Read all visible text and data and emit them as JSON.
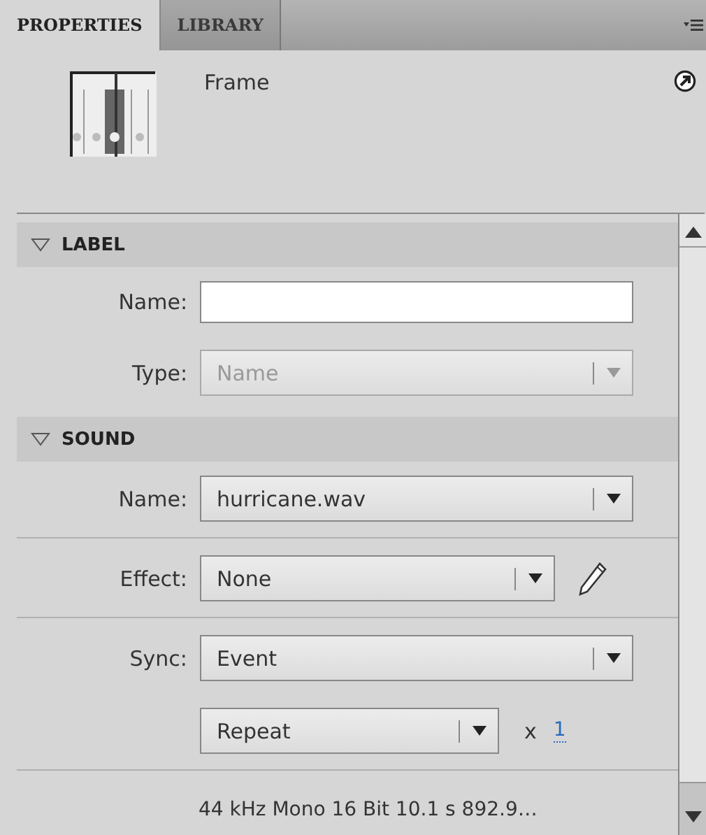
{
  "tabs": [
    {
      "label": "PROPERTIES",
      "selected": true
    },
    {
      "label": "LIBRARY",
      "selected": false
    }
  ],
  "header": {
    "title": "Frame"
  },
  "sections": [
    {
      "title": "LABEL",
      "expanded": true,
      "rows": [
        {
          "kind": "input",
          "label": "Name:"
        },
        {
          "kind": "dropdown",
          "label": "Type:",
          "value": "Name",
          "disabled": true
        }
      ]
    },
    {
      "title": "SOUND",
      "expanded": true,
      "rows": [
        {
          "kind": "dropdown",
          "label": "Name:",
          "value": "hurricane.wav",
          "disabled": false
        },
        {
          "kind": "divider"
        },
        {
          "kind": "dropdown_edit",
          "label": "Effect:",
          "value": "None",
          "disabled": false
        },
        {
          "kind": "divider"
        },
        {
          "kind": "dropdown",
          "label": "Sync:",
          "value": "Event",
          "disabled": false
        },
        {
          "kind": "repeat",
          "value": "Repeat",
          "times_prefix": "x",
          "times": "1"
        },
        {
          "kind": "divider"
        },
        {
          "kind": "info",
          "text": "44 kHz Mono 16 Bit 10.1 s 892.9…"
        }
      ]
    }
  ]
}
